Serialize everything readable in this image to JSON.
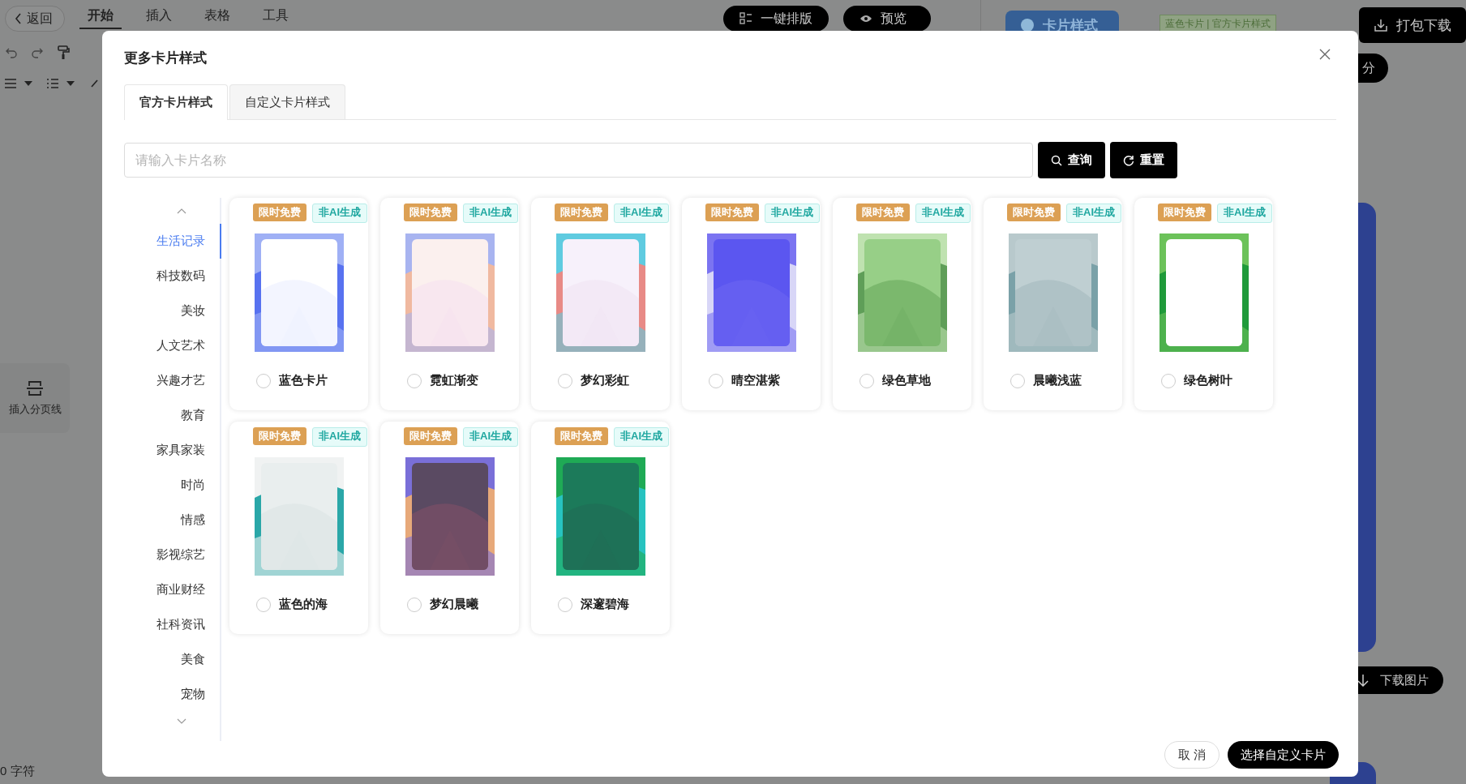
{
  "topbar": {
    "back": "返回",
    "menu": [
      {
        "label": "开始",
        "selected": true
      },
      {
        "label": "插入",
        "selected": false
      },
      {
        "label": "表格",
        "selected": false
      },
      {
        "label": "工具",
        "selected": false
      }
    ],
    "layout_button": "一键排版",
    "preview_button": "预览",
    "style_button": "卡片样式",
    "style_tag": "蓝色卡片 | 官方卡片样式",
    "download_all": "打包下载"
  },
  "split_button": "分",
  "side_tool": "插入分页线",
  "status": "0 字符",
  "download_image": "下载图片",
  "dialog": {
    "title": "更多卡片样式",
    "tabs": [
      {
        "label": "官方卡片样式",
        "selected": true
      },
      {
        "label": "自定义卡片样式",
        "selected": false
      }
    ],
    "search": {
      "placeholder": "请输入卡片名称",
      "query_button": "查询",
      "reset_button": "重置"
    },
    "categories": [
      {
        "label": "生活记录",
        "selected": true
      },
      {
        "label": "科技数码",
        "selected": false
      },
      {
        "label": "美妆",
        "selected": false
      },
      {
        "label": "人文艺术",
        "selected": false
      },
      {
        "label": "兴趣才艺",
        "selected": false
      },
      {
        "label": "教育",
        "selected": false
      },
      {
        "label": "家具家装",
        "selected": false
      },
      {
        "label": "时尚",
        "selected": false
      },
      {
        "label": "情感",
        "selected": false
      },
      {
        "label": "影视综艺",
        "selected": false
      },
      {
        "label": "商业财经",
        "selected": false
      },
      {
        "label": "社科资讯",
        "selected": false
      },
      {
        "label": "美食",
        "selected": false
      },
      {
        "label": "宠物",
        "selected": false
      }
    ],
    "cards": [
      {
        "name": "蓝色卡片",
        "badges": [
          "限时免费",
          "非AI生成"
        ],
        "selected": false
      },
      {
        "name": "霓虹渐变",
        "badges": [
          "限时免费",
          "非AI生成"
        ],
        "selected": false
      },
      {
        "name": "梦幻彩虹",
        "badges": [
          "限时免费",
          "非AI生成"
        ],
        "selected": false
      },
      {
        "name": "晴空湛紫",
        "badges": [
          "限时免费",
          "非AI生成"
        ],
        "selected": false
      },
      {
        "name": "绿色草地",
        "badges": [
          "限时免费",
          "非AI生成"
        ],
        "selected": false
      },
      {
        "name": "晨曦浅蓝",
        "badges": [
          "限时免费",
          "非AI生成"
        ],
        "selected": false
      },
      {
        "name": "绿色树叶",
        "badges": [
          "限时免费",
          "非AI生成"
        ],
        "selected": false
      },
      {
        "name": "蓝色的海",
        "badges": [
          "限时免费",
          "非AI生成"
        ],
        "selected": false
      },
      {
        "name": "梦幻晨曦",
        "badges": [
          "限时免费",
          "非AI生成"
        ],
        "selected": false
      },
      {
        "name": "深邃碧海",
        "badges": [
          "限时免费",
          "非AI生成"
        ],
        "selected": false
      }
    ],
    "cancel_button": "取 消",
    "confirm_button": "选择自定义卡片"
  }
}
